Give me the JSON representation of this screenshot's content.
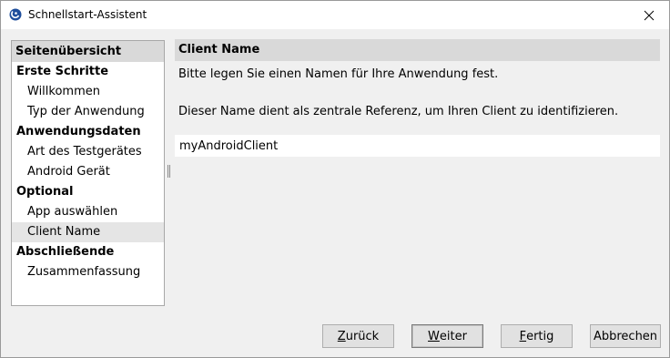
{
  "window": {
    "title": "Schnellstart-Assistent"
  },
  "sidebar": {
    "header": "Seitenübersicht",
    "groups": [
      {
        "label": "Erste Schritte",
        "items": [
          {
            "label": "Willkommen"
          },
          {
            "label": "Typ der Anwendung"
          }
        ]
      },
      {
        "label": "Anwendungsdaten",
        "items": [
          {
            "label": "Art des Testgerätes"
          },
          {
            "label": "Android Gerät"
          }
        ]
      },
      {
        "label": "Optional",
        "items": [
          {
            "label": "App auswählen"
          },
          {
            "label": "Client Name",
            "selected": true
          }
        ]
      },
      {
        "label": "Abschließende",
        "items": [
          {
            "label": "Zusammenfassung"
          }
        ]
      }
    ]
  },
  "main": {
    "header": "Client Name",
    "intro": "Bitte legen Sie einen Namen für Ihre Anwendung fest.",
    "description": "Dieser Name dient als zentrale Referenz, um Ihren Client zu identifizieren.",
    "input_value": "myAndroidClient"
  },
  "buttons": {
    "back": {
      "mnemonic": "Z",
      "rest": "urück"
    },
    "next": {
      "mnemonic": "W",
      "rest": "eiter"
    },
    "finish": {
      "mnemonic": "F",
      "rest": "ertig"
    },
    "cancel": {
      "label": "Abbrechen"
    }
  },
  "colors": {
    "accent": "#1f4e9c",
    "header_bg": "#d9d9d9",
    "selection": "#e5e5e5"
  }
}
